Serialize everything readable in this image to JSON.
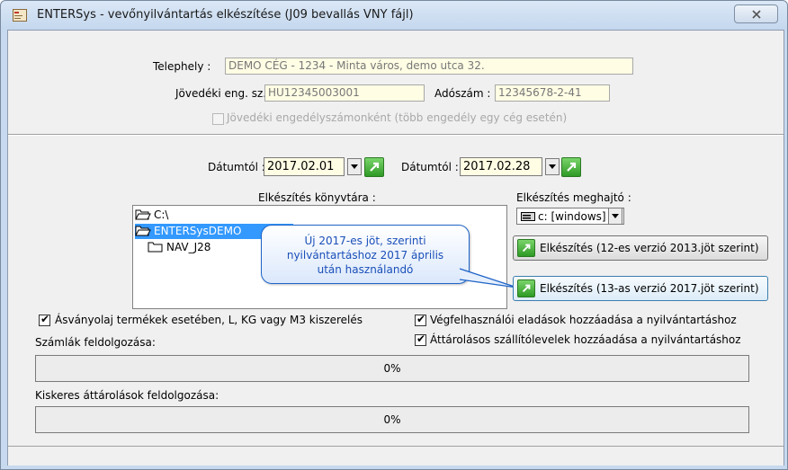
{
  "window": {
    "title": "ENTERSys - vevőnyilvántartás elkészítése (J09 bevallás VNY fájl)",
    "close_symbol": "☒"
  },
  "company": {
    "telephely_label": "Telephely :",
    "telephely_value": "DEMO CÉG - 1234 - Minta város, demo utca 32.",
    "jovedeki_label": "Jövedéki eng. sz. :",
    "jovedeki_value": "HU12345003001",
    "adoszam_label": "Adószám :",
    "adoszam_value": "12345678-2-41",
    "per_license_label": "Jövedéki engedélyszámonként (több engedély egy cég esetén)",
    "per_license_checked": false,
    "per_license_enabled": false
  },
  "dates": {
    "from_label": "Dátumtól :",
    "from_value": "2017.02.01",
    "to_label": "Dátumtól :",
    "to_value": "2017.02.28"
  },
  "directory": {
    "label": "Elkészítés könyvtára :",
    "items": [
      {
        "name": "C:\\",
        "icon": "open-folder-icon",
        "selected": false
      },
      {
        "name": "ENTERSysDEMO",
        "icon": "open-folder-icon",
        "selected": true
      },
      {
        "name": "NAV_J28",
        "icon": "folder-icon",
        "selected": false
      }
    ]
  },
  "drive": {
    "label": "Elkészítés meghajtó :",
    "value": "c: [windows]",
    "icon": "drive-icon"
  },
  "actions": {
    "v12_label": "Elkészítés (12-es verzió 2013.jöt szerint)",
    "v13_label": "Elkészítés (13-as verzió 2017.jöt szerint)"
  },
  "tooltip": {
    "lines": [
      "Új 2017-es jöt, szerinti",
      "nyilvántartáshoz 2017 április",
      "után használandó"
    ],
    "color": "#1f64c8"
  },
  "options": {
    "asvanyolaj_label": "Ásványolaj termékek esetében, L, KG vagy M3 kiszerelés",
    "asvanyolaj_checked": true,
    "vegfelhasznaloi_label": "Végfelhasználói eladások hozzáadása a nyilvántartáshoz",
    "vegfelhasznaloi_checked": true,
    "attarolasos_label": "Áttárolásos szállítólevelek hozzáadása a nyilvántartáshoz",
    "attarolasos_checked": true
  },
  "progress": {
    "invoices_label": "Számlák feldolgozása:",
    "invoices_value": "0%",
    "invoices_fraction": 0,
    "retail_label": "Kiskeres áttárolások feldolgozása:",
    "retail_value": "0%",
    "retail_fraction": 0
  },
  "colors": {
    "selection": "#3399ff",
    "field_bg": "#fffde4",
    "action_green": "#2e9a25"
  }
}
